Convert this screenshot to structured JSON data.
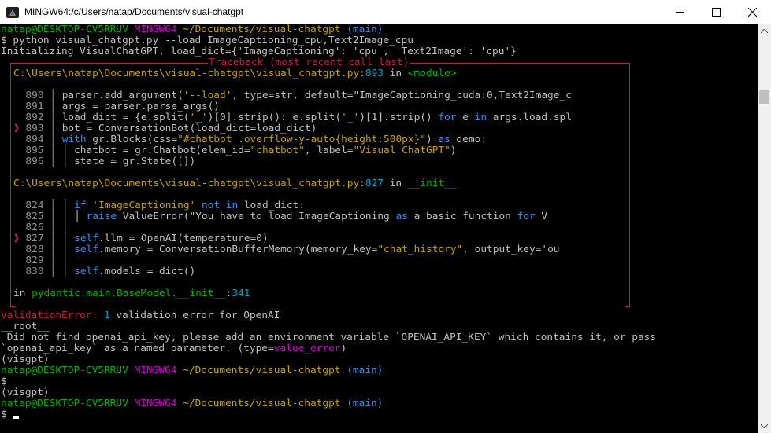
{
  "window": {
    "title": "MINGW64:/c/Users/natap/Documents/visual-chatgpt"
  },
  "colors": {
    "titlebar": "#ffffff",
    "terminal_bg": "#000000",
    "prompt_user": "#00b000",
    "prompt_env": "#d000d0",
    "prompt_path": "#c8a000",
    "prompt_branch": "#3b8eea",
    "traceback_border": "#c21f3a"
  },
  "icons": {
    "app": "mingw-terminal-icon",
    "minimize": "minimize-icon",
    "maximize": "maximize-icon",
    "close": "close-icon"
  },
  "terminal": {
    "lines": [
      "natap@DESKTOP-CV5RRUV MINGW64 ~/Documents/visual-chatgpt (main)",
      "$ python visual_chatgpt.py --load ImageCaptioning_cpu,Text2Image_cpu",
      "Initializing VisualChatGPT, load_dict={'ImageCaptioning': 'cpu', 'Text2Image': 'cpu'}",
      "Traceback (most recent call last)",
      "C:\\Users\\natap\\Documents\\visual-chatgpt\\visual_chatgpt.py:893 in <module>",
      "890    parser.add_argument('--load', type=str, default=\"ImageCaptioning_cuda:0,Text2Image_c",
      "891    args = parser.parse_args()",
      "892    load_dict = {e.split('_')[0].strip(): e.split('_')[1].strip() for e in args.load.spl",
      "893    bot = ConversationBot(load_dict=load_dict)",
      "894    with gr.Blocks(css=\"#chatbot .overflow-y-auto{height:500px}\") as demo:",
      "895    chatbot = gr.Chatbot(elem_id=\"chatbot\", label=\"Visual ChatGPT\")",
      "896    state = gr.State([])",
      "C:\\Users\\natap\\Documents\\visual-chatgpt\\visual_chatgpt.py:827 in __init__",
      "824    if 'ImageCaptioning' not in load_dict:",
      "825    raise ValueError(\"You have to load ImageCaptioning as a basic function for V",
      "826",
      "827    self.llm = OpenAI(temperature=0)",
      "828    self.memory = ConversationBufferMemory(memory_key=\"chat_history\", output_key='ou",
      "829",
      "830    self.models = dict()",
      "in pydantic.main.BaseModel.__init__:341",
      "ValidationError: 1 validation error for OpenAI",
      "__root__",
      "Did not find openai_api_key, please add an environment variable `OPENAI_API_KEY` which contains it, or pass",
      "`openai_api_key` as a named parameter. (type=value_error)",
      "(visgpt)",
      "natap@DESKTOP-CV5RRUV MINGW64 ~/Documents/visual-chatgpt (main)",
      "$",
      "(visgpt)",
      "natap@DESKTOP-CV5RRUV MINGW64 ~/Documents/visual-chatgpt (main)",
      "$"
    ]
  }
}
